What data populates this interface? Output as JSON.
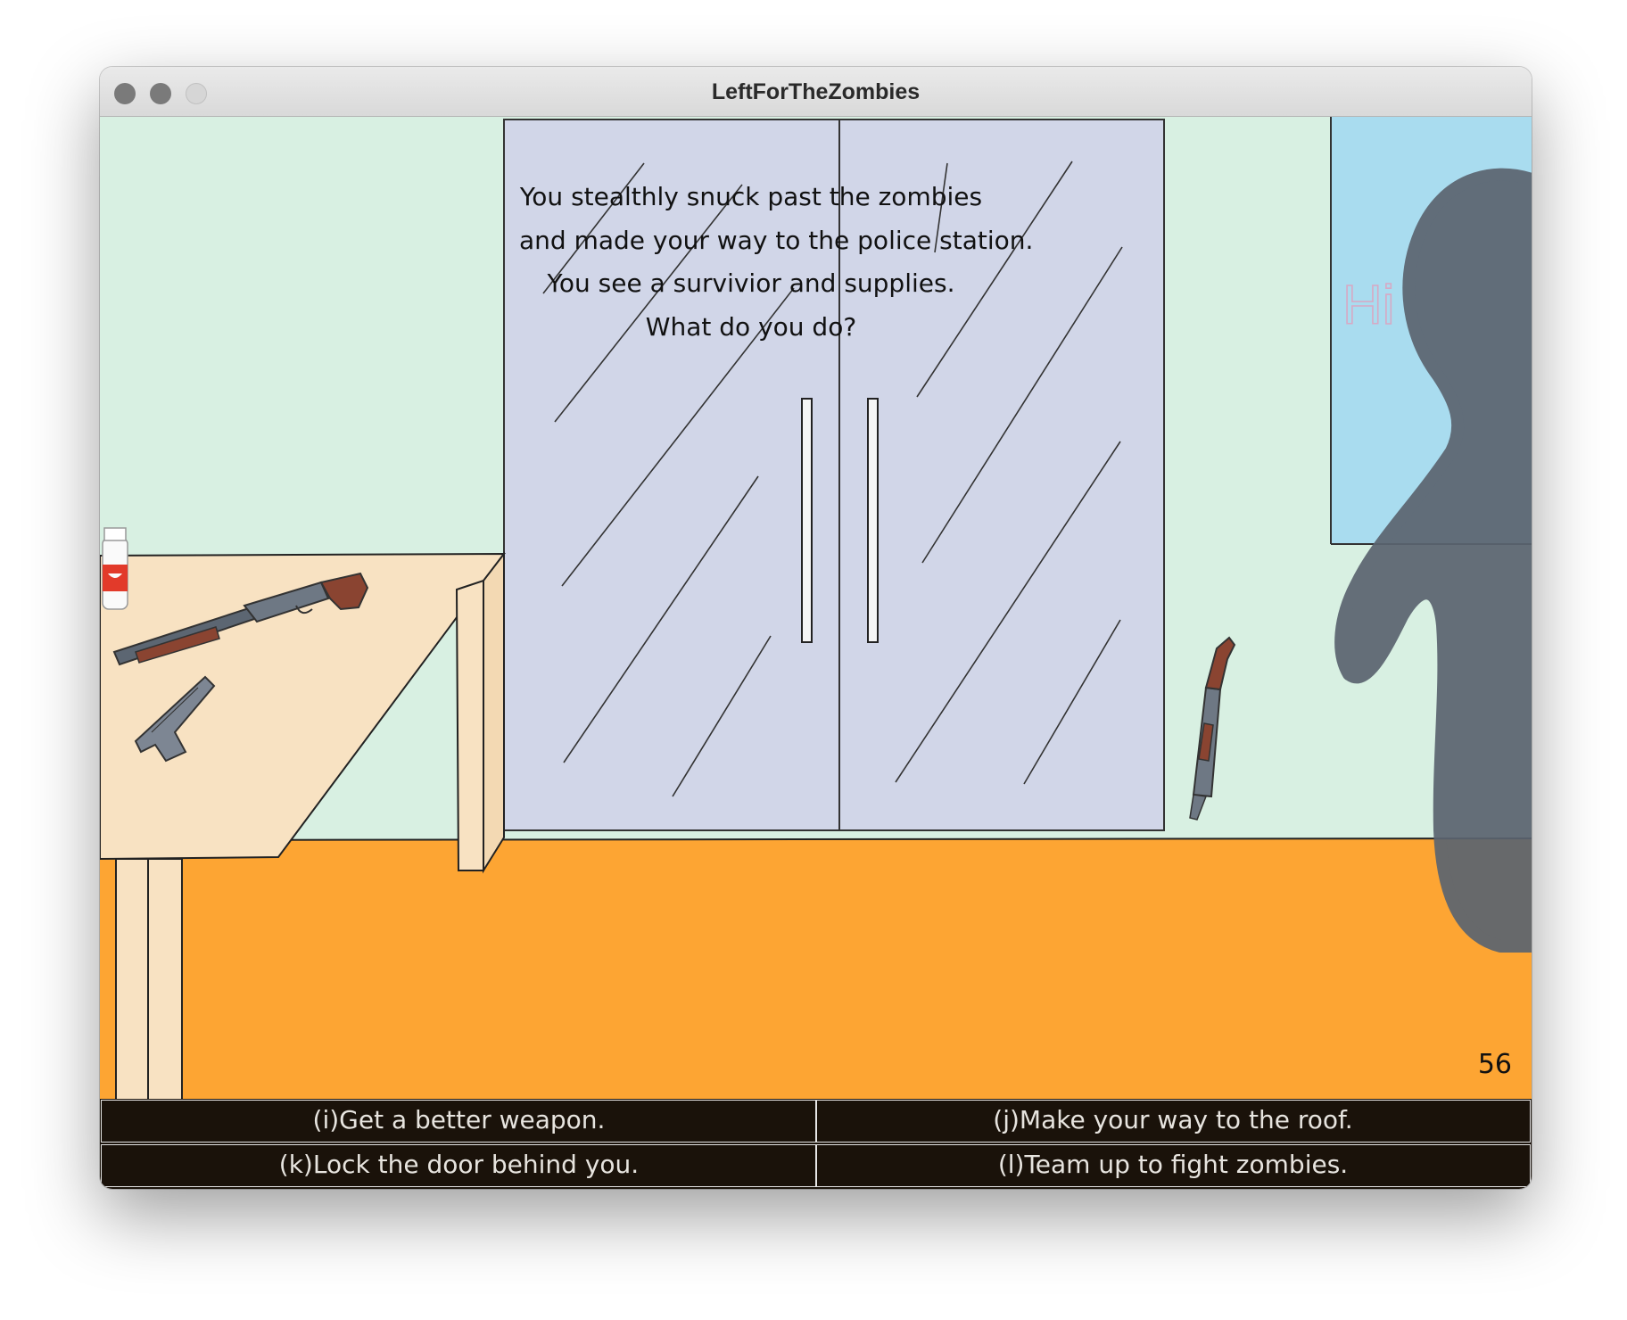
{
  "window": {
    "title": "LeftForTheZombies"
  },
  "scene": {
    "narration_lines": [
      "You stealthly snuck past the zombies",
      "and made your way to the police station.",
      "You see a survivior and supplies.",
      "What do you do?"
    ],
    "whiteboard_text": "Hi",
    "score": "56"
  },
  "choices": [
    {
      "key": "i",
      "label": "(i)Get a better weapon."
    },
    {
      "key": "j",
      "label": "(j)Make your way to the roof."
    },
    {
      "key": "k",
      "label": "(k)Lock the door behind you."
    },
    {
      "key": "l",
      "label": "(l)Team up to fight zombies."
    }
  ],
  "colors": {
    "wall": "#d8f0e2",
    "floor": "#fda533",
    "door_glass": "#d1d6e8",
    "table": "#f8e2c2",
    "window_glass": "#a9dcef",
    "silhouette": "#5b6470",
    "choice_bar": "#1a120a"
  }
}
